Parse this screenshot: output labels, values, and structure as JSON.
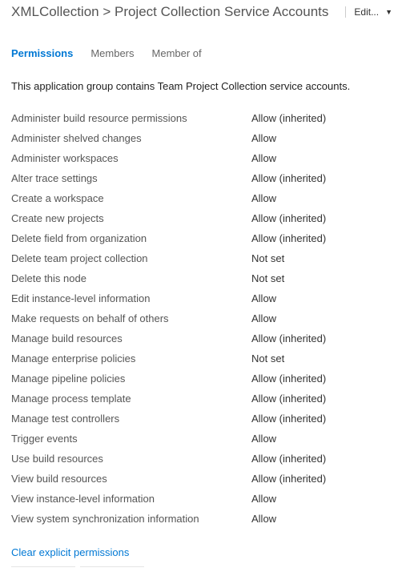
{
  "header": {
    "breadcrumb": "XMLCollection > Project Collection Service Accounts",
    "edit_label": "Edit..."
  },
  "tabs": {
    "permissions": "Permissions",
    "members": "Members",
    "member_of": "Member of"
  },
  "description": "This application group contains Team Project Collection service accounts.",
  "permissions": [
    {
      "name": "Administer build resource permissions",
      "value": "Allow (inherited)"
    },
    {
      "name": "Administer shelved changes",
      "value": "Allow"
    },
    {
      "name": "Administer workspaces",
      "value": "Allow"
    },
    {
      "name": "Alter trace settings",
      "value": "Allow (inherited)"
    },
    {
      "name": "Create a workspace",
      "value": "Allow"
    },
    {
      "name": "Create new projects",
      "value": "Allow (inherited)"
    },
    {
      "name": "Delete field from organization",
      "value": "Allow (inherited)"
    },
    {
      "name": "Delete team project collection",
      "value": "Not set"
    },
    {
      "name": "Delete this node",
      "value": "Not set"
    },
    {
      "name": "Edit instance-level information",
      "value": "Allow"
    },
    {
      "name": "Make requests on behalf of others",
      "value": "Allow"
    },
    {
      "name": "Manage build resources",
      "value": "Allow (inherited)"
    },
    {
      "name": "Manage enterprise policies",
      "value": "Not set"
    },
    {
      "name": "Manage pipeline policies",
      "value": "Allow (inherited)"
    },
    {
      "name": "Manage process template",
      "value": "Allow (inherited)"
    },
    {
      "name": "Manage test controllers",
      "value": "Allow (inherited)"
    },
    {
      "name": "Trigger events",
      "value": "Allow"
    },
    {
      "name": "Use build resources",
      "value": "Allow (inherited)"
    },
    {
      "name": "View build resources",
      "value": "Allow (inherited)"
    },
    {
      "name": "View instance-level information",
      "value": "Allow"
    },
    {
      "name": "View system synchronization information",
      "value": "Allow"
    }
  ],
  "actions": {
    "clear_explicit": "Clear explicit permissions"
  }
}
